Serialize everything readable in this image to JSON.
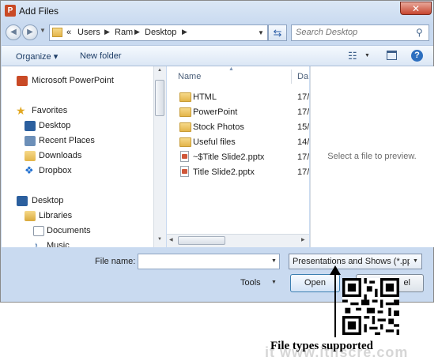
{
  "window": {
    "title": "Add Files",
    "app_icon": "P",
    "close_glyph": "✕"
  },
  "nav": {
    "back_glyph": "◀",
    "forward_glyph": "▶",
    "breadcrumb": [
      "«",
      "Users",
      "Ram",
      "Desktop"
    ],
    "search_placeholder": "Search Desktop"
  },
  "toolbar": {
    "organize_label": "Organize ▾",
    "new_folder_label": "New folder"
  },
  "sidebar": {
    "items": [
      {
        "label": "Microsoft PowerPoint",
        "icon": "powerpoint-icon",
        "indent": 0
      },
      {
        "label": "Favorites",
        "icon": "star-icon",
        "indent": 0
      },
      {
        "label": "Desktop",
        "icon": "desktop-icon",
        "indent": 1
      },
      {
        "label": "Recent Places",
        "icon": "recent-places-icon",
        "indent": 1
      },
      {
        "label": "Downloads",
        "icon": "downloads-icon",
        "indent": 1
      },
      {
        "label": "Dropbox",
        "icon": "dropbox-icon",
        "indent": 1
      },
      {
        "label": "Desktop",
        "icon": "desktop-icon",
        "indent": 0
      },
      {
        "label": "Libraries",
        "icon": "libraries-icon",
        "indent": 1
      },
      {
        "label": "Documents",
        "icon": "documents-icon",
        "indent": 2
      },
      {
        "label": "Music",
        "icon": "music-icon",
        "indent": 2
      }
    ]
  },
  "file_list": {
    "columns": [
      "Name",
      "Da"
    ],
    "rows": [
      {
        "name": "HTML",
        "date": "17/",
        "type": "folder"
      },
      {
        "name": "PowerPoint",
        "date": "17/",
        "type": "folder"
      },
      {
        "name": "Stock Photos",
        "date": "15/",
        "type": "folder"
      },
      {
        "name": "Useful files",
        "date": "14/",
        "type": "folder"
      },
      {
        "name": "~$Title Slide2.pptx",
        "date": "17/",
        "type": "pptx"
      },
      {
        "name": "Title Slide2.pptx",
        "date": "17/",
        "type": "pptx"
      }
    ]
  },
  "preview": {
    "text": "Select a file to preview."
  },
  "bottom": {
    "filename_label": "File name:",
    "filename_value": "",
    "filetype_value": "Presentations and Shows (*.ppt",
    "tools_label": "Tools",
    "open_label": "Open",
    "cancel_label": "el"
  },
  "annotation": {
    "caption": "File types supported"
  },
  "watermark": {
    "text": "it   www.itiiscre.com"
  },
  "colors": {
    "accent": "#3c7fb1",
    "titlebar": "#c9daf0",
    "close": "#c7452f"
  }
}
